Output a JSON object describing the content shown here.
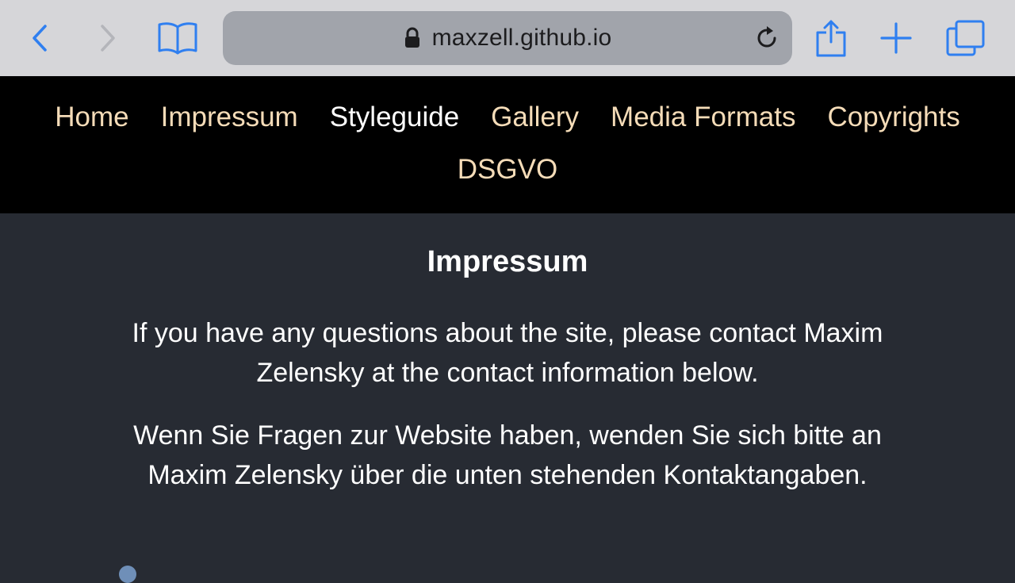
{
  "browser": {
    "url": "maxzell.github.io",
    "icons": {
      "back": "chevron-left-icon",
      "forward": "chevron-right-icon",
      "bookmarks": "book-icon",
      "lock": "lock-icon",
      "reload": "reload-icon",
      "share": "share-icon",
      "new_tab": "plus-icon",
      "tabs": "tabs-icon"
    },
    "accent_color": "#2f7ff0"
  },
  "nav": {
    "items": [
      {
        "label": "Home"
      },
      {
        "label": "Impressum"
      },
      {
        "label": "Styleguide"
      },
      {
        "label": "Gallery"
      },
      {
        "label": "Media Formats"
      },
      {
        "label": "Copyrights"
      },
      {
        "label": "DSGVO"
      }
    ],
    "link_color": "#f5dcb8",
    "current_color": "#ffffff"
  },
  "content": {
    "title": "Impressum",
    "paragraph_en": "If you have any questions about the site, please contact Maxim Zelensky at the contact information below.",
    "paragraph_de": "Wenn Sie Fragen zur Website haben, wenden Sie sich bitte an Maxim Zelensky über die unten stehenden Kontaktangaben."
  }
}
